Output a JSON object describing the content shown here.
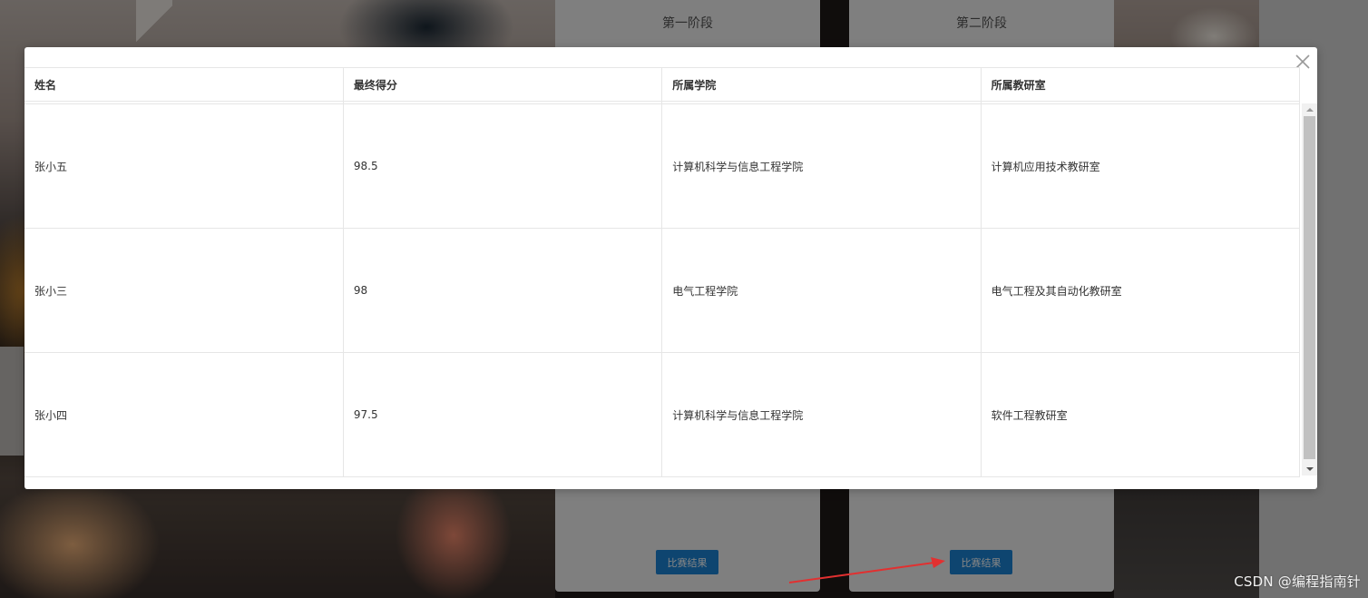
{
  "background": {
    "cards": [
      {
        "title": "第一阶段",
        "button_label": "比赛结果"
      },
      {
        "title": "第二阶段",
        "button_label": "比赛结果"
      }
    ],
    "watermark": "CSDN @编程指南针"
  },
  "modal": {
    "columns": [
      "姓名",
      "最终得分",
      "所属学院",
      "所属教研室"
    ],
    "rows": [
      [
        "张小五",
        "98.5",
        "计算机科学与信息工程学院",
        "计算机应用技术教研室"
      ],
      [
        "张小三",
        "98",
        "电气工程学院",
        "电气工程及其自动化教研室"
      ],
      [
        "张小四",
        "97.5",
        "计算机科学与信息工程学院",
        "软件工程教研室"
      ]
    ]
  },
  "colors": {
    "button": "#1b84d6",
    "annotation_arrow": "#e23030"
  }
}
